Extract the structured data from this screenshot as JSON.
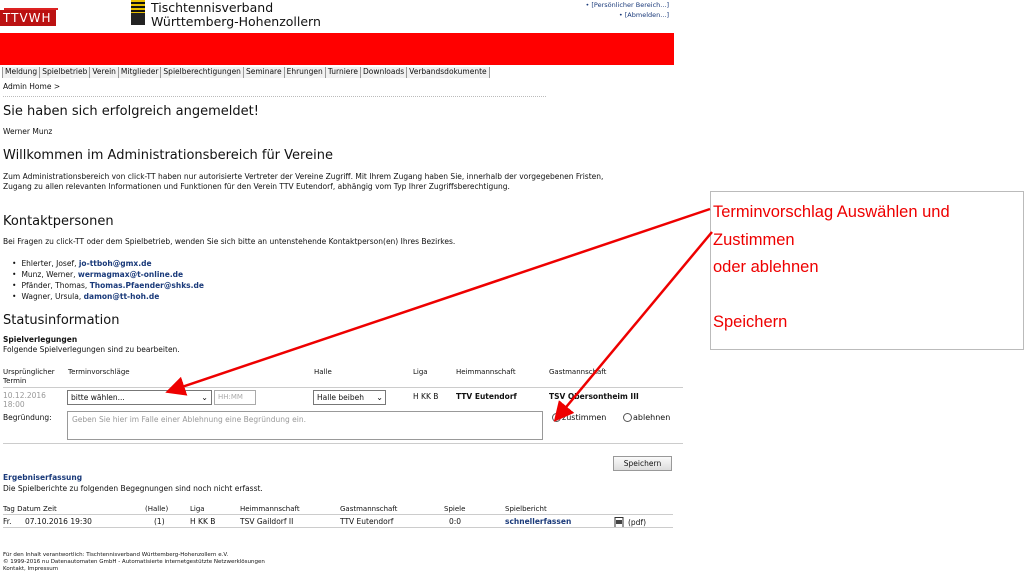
{
  "header": {
    "logo_text": "TTVWH",
    "org_name_line1": "Tischtennisverband",
    "org_name_line2": "Württemberg-Hohenzollern",
    "links": [
      "• [Persönlicher Bereich...]",
      "• [Abmelden...]"
    ]
  },
  "nav": [
    "Meldung",
    "Spielbetrieb",
    "Verein",
    "Mitglieder",
    "Spielberechtigungen",
    "Seminare",
    "Ehrungen",
    "Turniere",
    "Downloads",
    "Verbandsdokumente"
  ],
  "breadcrumb": "Admin Home >",
  "success_title": "Sie haben sich erfolgreich angemeldet!",
  "user_name": "Werner Munz",
  "welcome_title": "Willkommen im Administrationsbereich für Vereine",
  "intro": "Zum Administrationsbereich von click-TT haben nur autorisierte Vertreter der Vereine Zugriff. Mit Ihrem Zugang haben Sie, innerhalb der vorgegebenen Fristen, Zugang zu allen relevanten Informationen und Funktionen für den Verein TTV Eutendorf, abhängig vom Typ Ihrer Zugriffsberechtigung.",
  "contacts": {
    "title": "Kontaktpersonen",
    "intro": "Bei Fragen zu click-TT  oder dem Spielbetrieb, wenden Sie sich bitte an untenstehende Kontaktperson(en) Ihres Bezirkes.",
    "items": [
      {
        "name": "Ehlerter, Josef, ",
        "email": "jo-ttboh@gmx.de"
      },
      {
        "name": "Munz, Werner, ",
        "email": "wermagmax@t-online.de"
      },
      {
        "name": "Pfänder, Thomas, ",
        "email": "Thomas.Pfaender@shks.de"
      },
      {
        "name": "Wagner, Ursula, ",
        "email": "damon@tt-hoh.de"
      }
    ]
  },
  "status": {
    "title": "Statusinformation",
    "resched_title": "Spielverlegungen",
    "resched_sub": "Folgende Spielverlegungen sind zu bearbeiten.",
    "headers": {
      "orig": "Ursprünglicher Termin",
      "prop": "Terminvorschläge",
      "halle": "Halle",
      "liga": "Liga",
      "heim": "Heimmannschaft",
      "gast": "Gastmannschaft"
    },
    "row": {
      "orig_date": "10.12.2016",
      "orig_time": "18:00",
      "select_value": "bitte wählen...",
      "time_placeholder": "HH:MM",
      "halle_value": "Halle beibeh",
      "liga": "H KK B",
      "heim": "TTV Eutendorf",
      "gast": "TSV Obersontheim III"
    },
    "reason_label": "Begründung:",
    "reason_placeholder": "Geben Sie hier im Falle einer Ablehnung eine Begründung ein.",
    "agree": "zustimmen",
    "reject": "ablehnen",
    "save": "Speichern"
  },
  "results": {
    "title": "Ergebniserfassung",
    "sub": "Die Spielberichte zu folgenden Begegnungen sind noch nicht erfasst.",
    "headers": [
      "Tag Datum Zeit",
      "(Halle)",
      "Liga",
      "Heimmannschaft",
      "Gastmannschaft",
      "Spiele",
      "Spielbericht"
    ],
    "row": {
      "day": "Fr.",
      "datetime": "07.10.2016 19:30",
      "halle": "(1)",
      "liga": "H KK B",
      "heim": "TSV Gaildorf II",
      "gast": "TTV Eutendorf",
      "spiele": "0:0",
      "report": "schnellerfassen",
      "pdf": "(pdf)"
    }
  },
  "footer": [
    "Für den Inhalt verantwortlich: Tischtennisverband Württemberg-Hohenzollern e.V.",
    "© 1999-2016 nu Datenautomaten GmbH - Automatisierte internetgestützte Netzwerklösungen",
    "Kontakt, Impressum"
  ],
  "annotation": {
    "lines": [
      "Terminvorschlag Auswählen und",
      "Zustimmen",
      "oder ablehnen",
      "",
      "Speichern"
    ],
    "color": "#e00000"
  }
}
